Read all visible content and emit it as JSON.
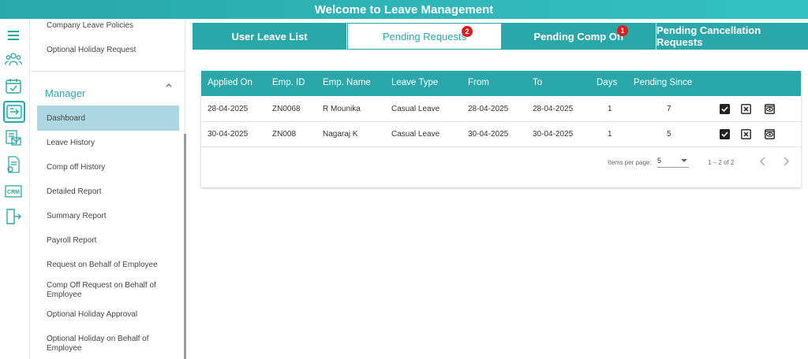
{
  "header": {
    "title": "Welcome to Leave Management"
  },
  "rail": {
    "icons": [
      "menu-icon",
      "team-icon",
      "calendar-check-icon",
      "transfer-icon",
      "mail-report-icon",
      "invoice-icon",
      "crm-icon",
      "logout-icon"
    ],
    "crm_text": "CRM"
  },
  "sidebar": {
    "top_items": [
      "Company Leave Policies",
      "Optional Holiday Request"
    ],
    "section_title": "Manager",
    "items": [
      "Dashboard",
      "Leave History",
      "Comp off History",
      "Detailed Report",
      "Summary Report",
      "Payroll Report",
      "Request on Behalf of Employee",
      "Comp Off Request on Behalf of Employee",
      "Optional Holiday Approval",
      "Optional Holiday on Behalf of Employee"
    ]
  },
  "tabs": [
    {
      "label": "User Leave List",
      "badge": ""
    },
    {
      "label": "Pending Requests",
      "badge": "2"
    },
    {
      "label": "Pending Comp Off",
      "badge": "1"
    },
    {
      "label": "Pending Cancellation Requests",
      "badge": ""
    }
  ],
  "table": {
    "columns": [
      "Applied On",
      "Emp. ID",
      "Emp. Name",
      "Leave Type",
      "From",
      "To",
      "Days",
      "Pending Since"
    ],
    "rows": [
      [
        "28-04-2025",
        "ZN0068",
        "R Mounika",
        "Casual Leave",
        "28-04-2025",
        "28-04-2025",
        "1",
        "7"
      ],
      [
        "30-04-2025",
        "ZN008",
        "Nagaraj K",
        "Casual Leave",
        "30-04-2025",
        "30-04-2025",
        "1",
        "5"
      ]
    ]
  },
  "pager": {
    "items_label": "Items per page:",
    "page_size": "5",
    "range": "1 – 2 of 2"
  },
  "colors": {
    "accent": "#2aa7a9",
    "badge": "#e01b1b",
    "active_item": "#acd7e2"
  }
}
